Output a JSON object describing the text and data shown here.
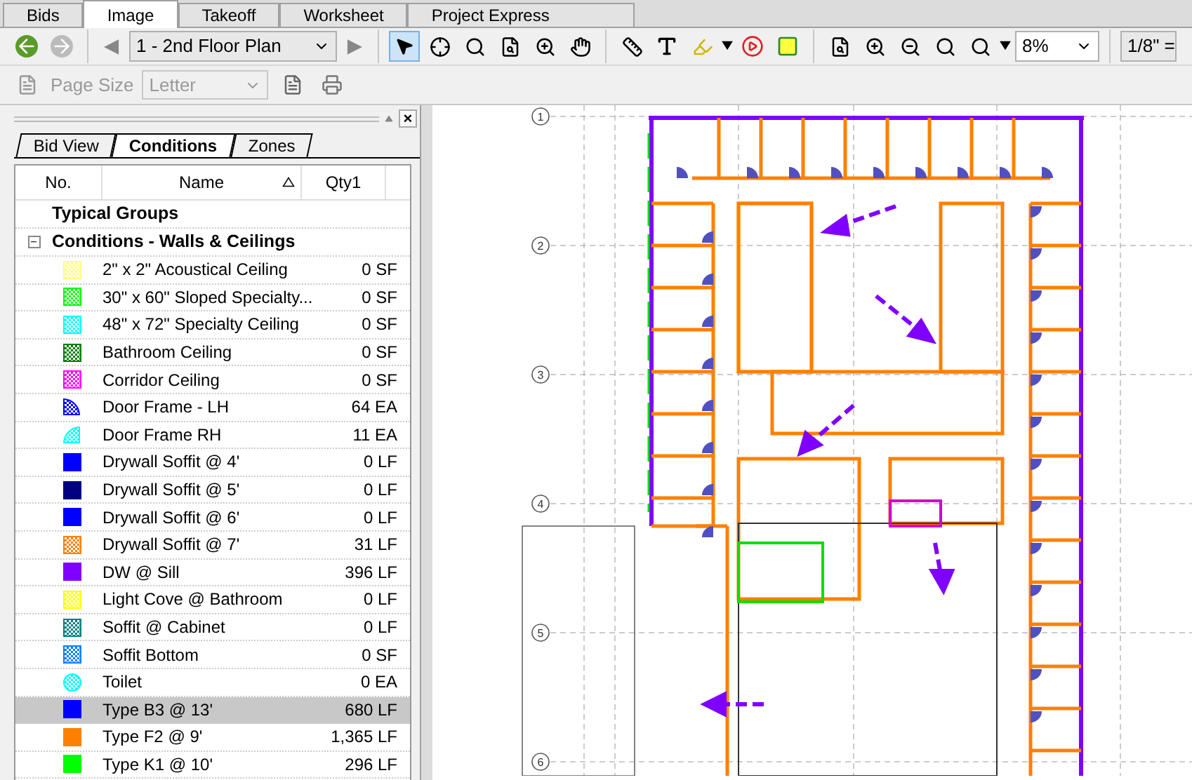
{
  "main_tabs": [
    {
      "label": "Bids",
      "selected": false
    },
    {
      "label": "Image",
      "selected": true
    },
    {
      "label": "Takeoff",
      "selected": false
    },
    {
      "label": "Worksheet",
      "selected": false
    },
    {
      "label": "Project Express",
      "selected": false
    }
  ],
  "toolbar": {
    "page_select": "1 - 2nd Floor Plan",
    "zoom_value": "8%",
    "scale_value": "1/8\" ="
  },
  "print_bar": {
    "page_size_label": "Page Size",
    "page_size_value": "Letter"
  },
  "panel": {
    "close": "×",
    "tabs": [
      {
        "label": "Bid View",
        "selected": false
      },
      {
        "label": "Conditions",
        "selected": true
      },
      {
        "label": "Zones",
        "selected": false
      }
    ],
    "columns": [
      "No.",
      "Name",
      "Qty1"
    ],
    "groups": [
      {
        "title": "Typical Groups",
        "kind": "plain"
      },
      {
        "title": "Conditions - Walls & Ceilings",
        "kind": "expandable",
        "expanded": true,
        "toggle": "−",
        "rows": [
          {
            "name": "2\" x 2\" Acoustical Ceiling",
            "qty": "0 SF",
            "kind": "hatch",
            "color": "#ffff80",
            "selected": false
          },
          {
            "name": "30\" x 60\" Sloped Specialty...",
            "qty": "0 SF",
            "kind": "hatch",
            "color": "#00ff00",
            "selected": false
          },
          {
            "name": "48\" x 72\" Specialty Ceiling",
            "qty": "0 SF",
            "kind": "hatch",
            "color": "#00ffff",
            "selected": false
          },
          {
            "name": "Bathroom Ceiling",
            "qty": "0 SF",
            "kind": "hatch",
            "color": "#008000",
            "selected": false
          },
          {
            "name": "Corridor Ceiling",
            "qty": "0 SF",
            "kind": "hatch",
            "color": "#ff00ff",
            "selected": false
          },
          {
            "name": "Door Frame - LH",
            "qty": "64 EA",
            "kind": "door-left",
            "color": "#0000ff",
            "selected": false
          },
          {
            "name": "Door Frame RH",
            "qty": "11 EA",
            "kind": "door-right",
            "color": "#00ffff",
            "selected": false
          },
          {
            "name": "Drywall Soffit @ 4'",
            "qty": "0 LF",
            "kind": "solid",
            "color": "#0000ff",
            "selected": false
          },
          {
            "name": "Drywall Soffit @ 5'",
            "qty": "0 LF",
            "kind": "solid",
            "color": "#000080",
            "selected": false
          },
          {
            "name": "Drywall Soffit @ 6'",
            "qty": "0 LF",
            "kind": "solid",
            "color": "#0000ff",
            "selected": false
          },
          {
            "name": "Drywall Soffit @ 7'",
            "qty": "31 LF",
            "kind": "hatch",
            "color": "#ff8000",
            "selected": false
          },
          {
            "name": "DW @ Sill",
            "qty": "396 LF",
            "kind": "solid",
            "color": "#8000ff",
            "selected": false
          },
          {
            "name": "Light Cove @ Bathroom",
            "qty": "0 LF",
            "kind": "hatch",
            "color": "#ffff00",
            "selected": false
          },
          {
            "name": "Soffit @ Cabinet",
            "qty": "0 LF",
            "kind": "hatch",
            "color": "#008080",
            "selected": false
          },
          {
            "name": "Soffit Bottom",
            "qty": "0 SF",
            "kind": "hatch",
            "color": "#0080ff",
            "selected": false
          },
          {
            "name": "Toilet",
            "qty": "0 EA",
            "kind": "circle",
            "color": "#00ffff",
            "selected": false
          },
          {
            "name": "Type B3 @ 13'",
            "qty": "680 LF",
            "kind": "solid",
            "color": "#0000ff",
            "selected": true
          },
          {
            "name": "Type F2 @ 9'",
            "qty": "1,365 LF",
            "kind": "solid",
            "color": "#ff8000",
            "selected": false
          },
          {
            "name": "Type K1 @ 10'",
            "qty": "296 LF",
            "kind": "solid",
            "color": "#00ff00",
            "selected": false
          }
        ]
      }
    ]
  },
  "plan": {
    "grid_markers": [
      "1",
      "2",
      "3",
      "4",
      "5",
      "6"
    ]
  }
}
